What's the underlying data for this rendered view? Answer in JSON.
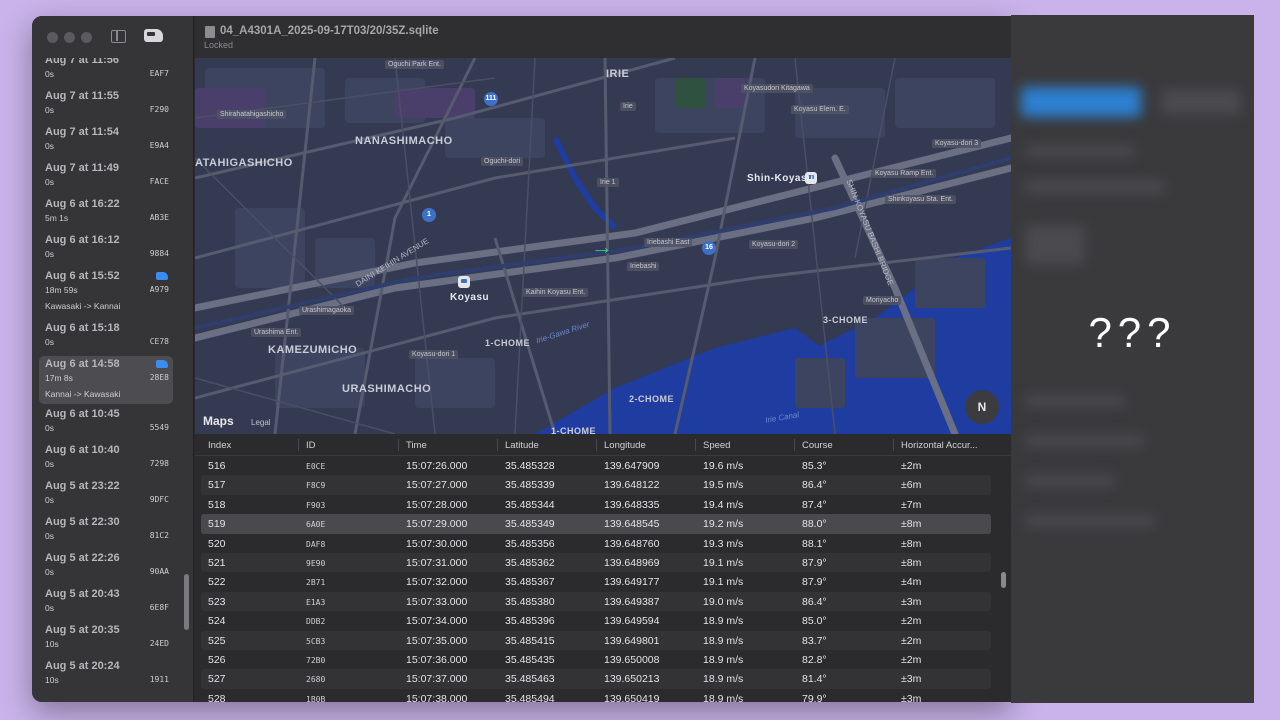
{
  "document": {
    "title": "04_A4301A_2025-09-17T03/20/35Z.sqlite",
    "status": "Locked"
  },
  "sidebar": {
    "items": [
      {
        "title": "Aug 7 at 11:56",
        "duration": "0s",
        "id": "EAF7",
        "route": "",
        "train": false,
        "selected": false
      },
      {
        "title": "Aug 7 at 11:55",
        "duration": "0s",
        "id": "F290",
        "route": "",
        "train": false,
        "selected": false
      },
      {
        "title": "Aug 7 at 11:54",
        "duration": "0s",
        "id": "E9A4",
        "route": "",
        "train": false,
        "selected": false
      },
      {
        "title": "Aug 7 at 11:49",
        "duration": "0s",
        "id": "FACE",
        "route": "",
        "train": false,
        "selected": false
      },
      {
        "title": "Aug 6 at 16:22",
        "duration": "5m 1s",
        "id": "AB3E",
        "route": "",
        "train": false,
        "selected": false
      },
      {
        "title": "Aug 6 at 16:12",
        "duration": "0s",
        "id": "9884",
        "route": "",
        "train": false,
        "selected": false
      },
      {
        "title": "Aug 6 at 15:52",
        "duration": "18m 59s",
        "id": "A979",
        "route": "Kawasaki -> Kannai",
        "train": true,
        "selected": false
      },
      {
        "title": "Aug 6 at 15:18",
        "duration": "0s",
        "id": "CE78",
        "route": "",
        "train": false,
        "selected": false
      },
      {
        "title": "Aug 6 at 14:58",
        "duration": "17m 8s",
        "id": "28E8",
        "route": "Kannai -> Kawasaki",
        "train": true,
        "selected": true
      },
      {
        "title": "Aug 6 at 10:45",
        "duration": "0s",
        "id": "5549",
        "route": "",
        "train": false,
        "selected": false
      },
      {
        "title": "Aug 6 at 10:40",
        "duration": "0s",
        "id": "7298",
        "route": "",
        "train": false,
        "selected": false
      },
      {
        "title": "Aug 5 at 23:22",
        "duration": "0s",
        "id": "9DFC",
        "route": "",
        "train": false,
        "selected": false
      },
      {
        "title": "Aug 5 at 22:30",
        "duration": "0s",
        "id": "81C2",
        "route": "",
        "train": false,
        "selected": false
      },
      {
        "title": "Aug 5 at 22:26",
        "duration": "0s",
        "id": "90AA",
        "route": "",
        "train": false,
        "selected": false
      },
      {
        "title": "Aug 5 at 20:43",
        "duration": "0s",
        "id": "6E8F",
        "route": "",
        "train": false,
        "selected": false
      },
      {
        "title": "Aug 5 at 20:35",
        "duration": "10s",
        "id": "24ED",
        "route": "",
        "train": false,
        "selected": false
      },
      {
        "title": "Aug 5 at 20:24",
        "duration": "10s",
        "id": "1911",
        "route": "",
        "train": false,
        "selected": false
      }
    ]
  },
  "map": {
    "districts": [
      "IRIE",
      "NANASHIMACHO",
      "ATAHIGASHICHO",
      "KAMEZUMICHO",
      "URASHIMACHO",
      "1-CHOME",
      "2-CHOME",
      "3-CHOME",
      "1-CHOME"
    ],
    "stations": [
      "Shin-Koyasu",
      "Koyasu"
    ],
    "streets": [
      "DAINI KEIHIN AVENUE",
      "SHIN-KOYASU BASHI BRIDGE"
    ],
    "river": "Irie-Gawa River",
    "canal": "Irie Canal",
    "tags": [
      "Oguchi Park Ent.",
      "Koyasudori Kitagawa",
      "Koyasu Elem. E.",
      "Koyasu-dori 3",
      "Shirahatahigashicho",
      "Oguchi-dori",
      "Irie 1",
      "Koyasu Ramp Ent.",
      "Shinkoyasu Sta. Ent.",
      "Irie",
      "Iriebashi East",
      "Koyasu-dori 2",
      "Iriebashi",
      "Kaihin Koyasu Ent.",
      "Urashimagaoka",
      "Urashima Ent.",
      "Koyasu-dori 1",
      "Moriyacho"
    ],
    "shields": [
      "111",
      "1",
      "16"
    ],
    "logo": "Maps",
    "legal": "Legal",
    "compass": "N"
  },
  "table": {
    "columns": [
      "Index",
      "ID",
      "Time",
      "Latitude",
      "Longitude",
      "Speed",
      "Course",
      "Horizontal Accur..."
    ],
    "rows": [
      [
        "516",
        "E0CE",
        "15:07:26.000",
        "35.485328",
        "139.647909",
        "19.6 m/s",
        "85.3°",
        "±2m"
      ],
      [
        "517",
        "F8C9",
        "15:07:27.000",
        "35.485339",
        "139.648122",
        "19.5 m/s",
        "86.4°",
        "±6m"
      ],
      [
        "518",
        "F903",
        "15:07:28.000",
        "35.485344",
        "139.648335",
        "19.4 m/s",
        "87.4°",
        "±7m"
      ],
      [
        "519",
        "6A0E",
        "15:07:29.000",
        "35.485349",
        "139.648545",
        "19.2 m/s",
        "88.0°",
        "±8m"
      ],
      [
        "520",
        "DAF8",
        "15:07:30.000",
        "35.485356",
        "139.648760",
        "19.3 m/s",
        "88.1°",
        "±8m"
      ],
      [
        "521",
        "9E90",
        "15:07:31.000",
        "35.485362",
        "139.648969",
        "19.1 m/s",
        "87.9°",
        "±8m"
      ],
      [
        "522",
        "2B71",
        "15:07:32.000",
        "35.485367",
        "139.649177",
        "19.1 m/s",
        "87.9°",
        "±4m"
      ],
      [
        "523",
        "E1A3",
        "15:07:33.000",
        "35.485380",
        "139.649387",
        "19.0 m/s",
        "86.4°",
        "±3m"
      ],
      [
        "524",
        "DDB2",
        "15:07:34.000",
        "35.485396",
        "139.649594",
        "18.9 m/s",
        "85.0°",
        "±2m"
      ],
      [
        "525",
        "5CB3",
        "15:07:35.000",
        "35.485415",
        "139.649801",
        "18.9 m/s",
        "83.7°",
        "±2m"
      ],
      [
        "526",
        "72B0",
        "15:07:36.000",
        "35.485435",
        "139.650008",
        "18.9 m/s",
        "82.8°",
        "±2m"
      ],
      [
        "527",
        "2680",
        "15:07:37.000",
        "35.485463",
        "139.650213",
        "18.9 m/s",
        "81.4°",
        "±3m"
      ],
      [
        "528",
        "1B0B",
        "15:07:38.000",
        "35.485494",
        "139.650419",
        "18.9 m/s",
        "79.9°",
        "±3m"
      ]
    ],
    "selected_index": 3
  },
  "right_panel": {
    "text": "???"
  },
  "colors": {
    "accent": "#3b8cf0",
    "position_arrow": "#37d468",
    "background": "#c9b3ea"
  }
}
